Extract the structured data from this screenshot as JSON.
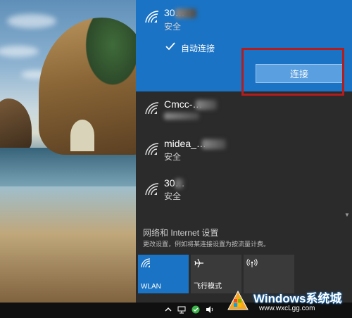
{
  "networks": [
    {
      "name": "30…",
      "status": "安全",
      "expanded": true,
      "auto_connect_label": "自动连接",
      "auto_connect_checked": true,
      "connect_label": "连接"
    },
    {
      "name": "Cmcc-…",
      "status": ""
    },
    {
      "name": "midea_…",
      "status": "安全"
    },
    {
      "name": "30…",
      "status": "安全"
    }
  ],
  "settings": {
    "title": "网络和 Internet 设置",
    "description": "更改设置，例如将某连接设置为按流量计费。"
  },
  "quick_actions": [
    {
      "label": "WLAN",
      "icon": "wifi-icon",
      "active": true
    },
    {
      "label": "飞行模式",
      "icon": "airplane-icon",
      "active": false
    },
    {
      "label": "",
      "icon": "mobile-hotspot-icon",
      "active": false
    }
  ],
  "taskbar": {
    "tray_icons": [
      "chevron-up-icon",
      "network-icon",
      "green-app-icon",
      "volume-icon"
    ]
  },
  "watermark": {
    "title": "Windows系统城",
    "url": "www.wxcLgg.com"
  },
  "colors": {
    "accent": "#1a73c4",
    "panel_bg": "#2b2b2b",
    "highlight_box": "#b31d1d",
    "tile_inactive": "#3a3a3a"
  }
}
